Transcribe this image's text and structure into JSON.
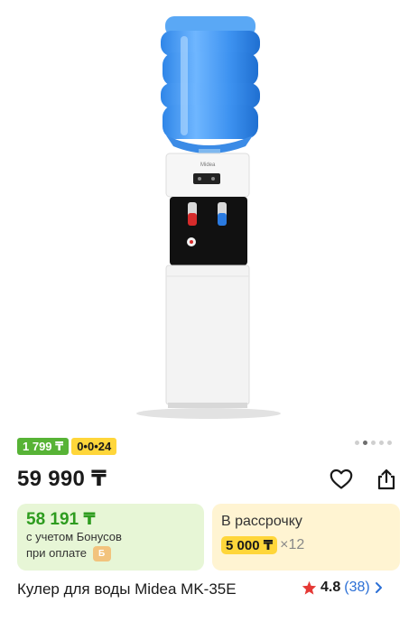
{
  "product": {
    "name": "Кулер для воды Midea MK-35E",
    "brand": "Midea",
    "price": "59 990 ₸"
  },
  "badges": {
    "price_badge": "1 799 ₸",
    "installment_badge": "0•0•24"
  },
  "gallery": {
    "total_images": 5,
    "active_index": 1
  },
  "bonus_card": {
    "price": "58 191 ₸",
    "line1": "с учетом Бонусов",
    "line2": "при оплате",
    "chip": "Б"
  },
  "installment_card": {
    "title": "В рассрочку",
    "amount": "5 000 ₸",
    "times": "×12"
  },
  "rating": {
    "value": "4.8",
    "count": "(38)"
  },
  "colors": {
    "green_badge": "#57b336",
    "yellow_badge": "#ffd63a",
    "green_card": "#e7f6d6",
    "yellow_card": "#fff4d2",
    "bonus_price": "#2e9c1f",
    "star": "#e53935",
    "link": "#2b6fd6"
  }
}
